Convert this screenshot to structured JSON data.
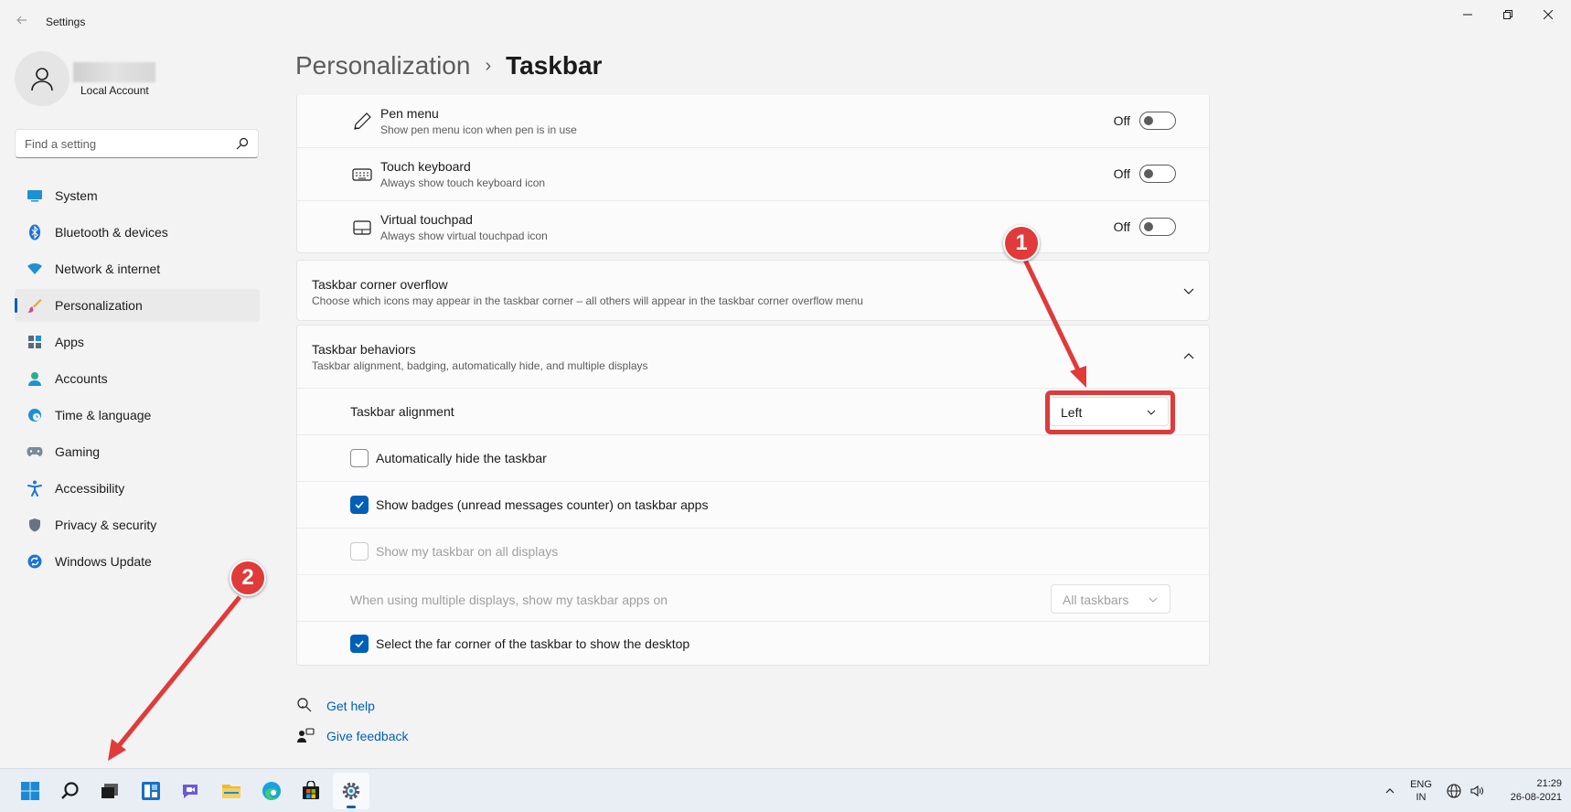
{
  "window": {
    "title": "Settings",
    "back_icon": "back-arrow-icon",
    "controls": [
      "minimize",
      "maximize",
      "close"
    ]
  },
  "profile": {
    "account_type": "Local Account"
  },
  "search": {
    "placeholder": "Find a setting"
  },
  "sidebar": {
    "items": [
      {
        "label": "System",
        "icon": "system-icon",
        "active": false
      },
      {
        "label": "Bluetooth & devices",
        "icon": "bluetooth-icon",
        "active": false
      },
      {
        "label": "Network & internet",
        "icon": "wifi-icon",
        "active": false
      },
      {
        "label": "Personalization",
        "icon": "brush-icon",
        "active": true
      },
      {
        "label": "Apps",
        "icon": "apps-icon",
        "active": false
      },
      {
        "label": "Accounts",
        "icon": "account-icon",
        "active": false
      },
      {
        "label": "Time & language",
        "icon": "clock-globe-icon",
        "active": false
      },
      {
        "label": "Gaming",
        "icon": "gamepad-icon",
        "active": false
      },
      {
        "label": "Accessibility",
        "icon": "accessibility-icon",
        "active": false
      },
      {
        "label": "Privacy & security",
        "icon": "shield-icon",
        "active": false
      },
      {
        "label": "Windows Update",
        "icon": "update-icon",
        "active": false
      }
    ]
  },
  "header": {
    "parent": "Personalization",
    "separator": "›",
    "current": "Taskbar"
  },
  "taskbar_icons_card": {
    "rows": [
      {
        "title": "Pen menu",
        "desc": "Show pen menu icon when pen is in use",
        "state": "Off"
      },
      {
        "title": "Touch keyboard",
        "desc": "Always show touch keyboard icon",
        "state": "Off"
      },
      {
        "title": "Virtual touchpad",
        "desc": "Always show virtual touchpad icon",
        "state": "Off"
      }
    ]
  },
  "corner_overflow": {
    "title": "Taskbar corner overflow",
    "desc": "Choose which icons may appear in the taskbar corner – all others will appear in the taskbar corner overflow menu",
    "expanded": false
  },
  "behaviors": {
    "title": "Taskbar behaviors",
    "desc": "Taskbar alignment, badging, automatically hide, and multiple displays",
    "expanded": true,
    "alignment_label": "Taskbar alignment",
    "alignment_value": "Left",
    "auto_hide_label": "Automatically hide the taskbar",
    "auto_hide_checked": false,
    "badges_label": "Show badges (unread messages counter) on taskbar apps",
    "badges_checked": true,
    "all_displays_label": "Show my taskbar on all displays",
    "all_displays_checked": false,
    "multi_display_label": "When using multiple displays, show my taskbar apps on",
    "multi_display_value": "All taskbars",
    "far_corner_label": "Select the far corner of the taskbar to show the desktop",
    "far_corner_checked": true
  },
  "footer": {
    "get_help": "Get help",
    "give_feedback": "Give feedback"
  },
  "annotations": {
    "badge1": "1",
    "badge2": "2",
    "color": "#e03a3a"
  },
  "system_taskbar": {
    "apps": [
      "start-icon",
      "search-icon",
      "task-view-icon",
      "widgets-icon",
      "chat-icon",
      "file-explorer-icon",
      "edge-icon",
      "store-icon",
      "settings-icon"
    ],
    "lang_line1": "ENG",
    "lang_line2": "IN",
    "time": "21:29",
    "date": "26-08-2021"
  },
  "colors": {
    "accent": "#005fb8",
    "background": "#f3f3f3",
    "card": "#fbfbfb"
  }
}
